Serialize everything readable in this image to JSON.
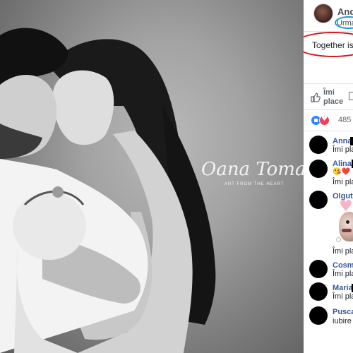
{
  "photo": {
    "watermark": {
      "script_text": "Oana Toma",
      "subtitle": "ART FROM THE HEART"
    }
  },
  "post": {
    "author_name": "And",
    "follow_label": "Urma",
    "caption": "Together is n",
    "like_label": "Îmi place",
    "reaction_count": "485"
  },
  "comments": [
    {
      "name": "Anna",
      "text": "Îmi pla"
    },
    {
      "name": "Alina",
      "text": "Îmi pla",
      "emoji": "😘❤️"
    },
    {
      "name": "Olguta",
      "text": "Îmi pla"
    },
    {
      "name": "Cosmi",
      "text": "Îmi pla"
    },
    {
      "name": "Maria",
      "text": "Îmi pla"
    },
    {
      "name": "Pusca",
      "text": "iubire !"
    }
  ],
  "colors": {
    "link_blue": "#385898",
    "highlight_red": "#d6161b",
    "highlight_blue": "#1a9bd7",
    "like_blue": "#2d88ff",
    "love_red": "#f33e58"
  }
}
